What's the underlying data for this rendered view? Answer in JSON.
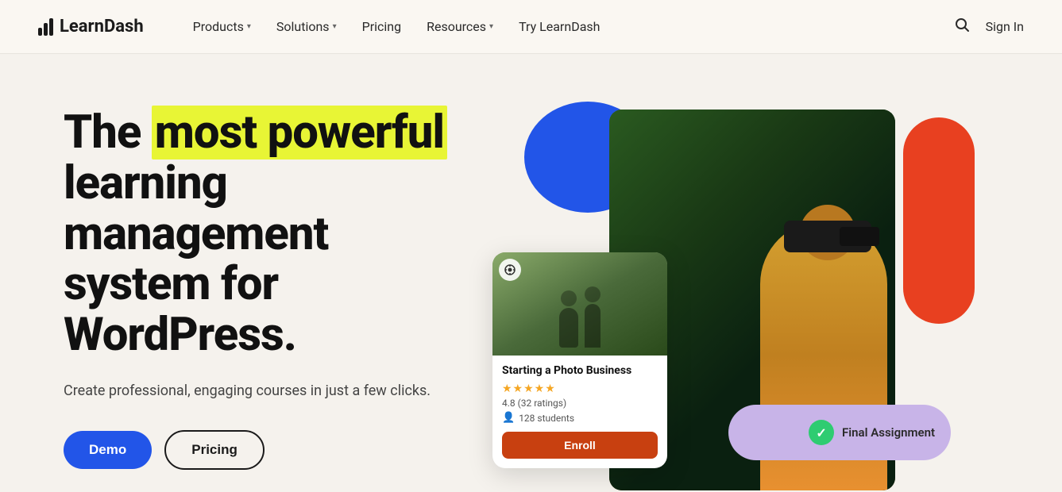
{
  "nav": {
    "logo_text": "LearnDash",
    "items": [
      {
        "label": "Products",
        "hasDropdown": true
      },
      {
        "label": "Solutions",
        "hasDropdown": true
      },
      {
        "label": "Pricing",
        "hasDropdown": false
      },
      {
        "label": "Resources",
        "hasDropdown": true
      },
      {
        "label": "Try LearnDash",
        "hasDropdown": false
      }
    ],
    "signin_label": "Sign In"
  },
  "hero": {
    "heading_prefix": "The ",
    "heading_highlight": "most powerful",
    "heading_suffix": " learning management system for WordPress.",
    "subtitle": "Create professional, engaging courses in just a few clicks.",
    "btn_demo": "Demo",
    "btn_pricing": "Pricing"
  },
  "course_card": {
    "title": "Starting a Photo Business",
    "stars": "★★★★★",
    "rating": "4.8 (32 ratings)",
    "students": "128 students",
    "enroll_label": "Enroll"
  },
  "assignment_badge": {
    "label": "Final Assignment"
  },
  "colors": {
    "accent_blue": "#2255e8",
    "accent_red": "#e84020",
    "accent_purple": "#c8b4e8",
    "highlight_yellow": "#e8f535",
    "star_color": "#f5a623",
    "enroll_btn": "#c84010",
    "check_green": "#2ecc71"
  }
}
